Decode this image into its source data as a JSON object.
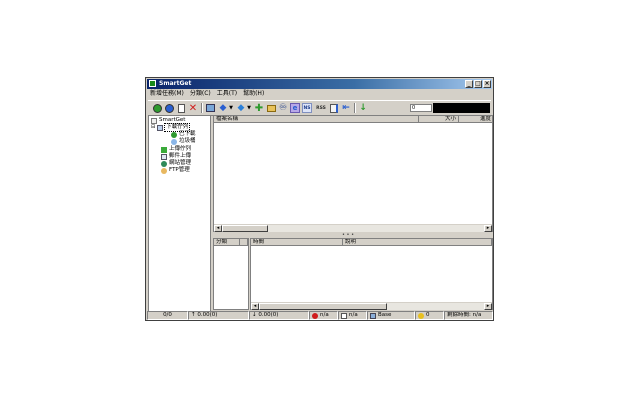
{
  "window": {
    "title": "SmartGet",
    "buttons": {
      "minimize": "_",
      "maximize": "□",
      "close": "×"
    }
  },
  "menu": [
    "新增任務(M)",
    "分類(C)",
    "工具(T)",
    "幫助(H)"
  ],
  "toolbar": {
    "buttons": [
      "start-icon",
      "stop-icon",
      "new-icon",
      "delete-icon",
      "properties-icon",
      "move-up-icon",
      "move-down-icon",
      "add-green-icon",
      "folder-icon",
      "binoculars-icon",
      "ie-icon",
      "ns-icon",
      "rss-icon",
      "edit-icon",
      "export-icon",
      "speed-icon"
    ],
    "labels": {
      "ns": "NS",
      "rss": "RSS"
    },
    "spin_value": "0"
  },
  "tree": {
    "root": "SmartGet",
    "downloading": "下載佇列",
    "downloaded": "已下載",
    "trash": "垃圾桶",
    "upload_queue": "上傳佇列",
    "mail_upload": "郵件上傳",
    "site_manager": "網站管理",
    "ftp_manager": "FTP管理"
  },
  "file_list": {
    "columns": [
      "檔案名稱",
      "大小",
      "進度"
    ]
  },
  "category_list": {
    "columns": [
      "分類",
      ""
    ]
  },
  "log_list": {
    "columns": [
      "時間",
      "說明"
    ]
  },
  "status": {
    "count": "0/0",
    "upload": "↑ 0.00(0)",
    "download": "↓ 0.00(0)",
    "error": "n/a",
    "disk": "n/a",
    "mode": "Base",
    "tasks": "0",
    "remaining_time": "剩餘時間: n/a"
  },
  "colors": {
    "title_start": "#0a246a",
    "title_end": "#a6caf0",
    "face": "#d4d0c8",
    "green": "#2e9a2e",
    "blue": "#2a5fd0",
    "red": "#d01c1c"
  }
}
